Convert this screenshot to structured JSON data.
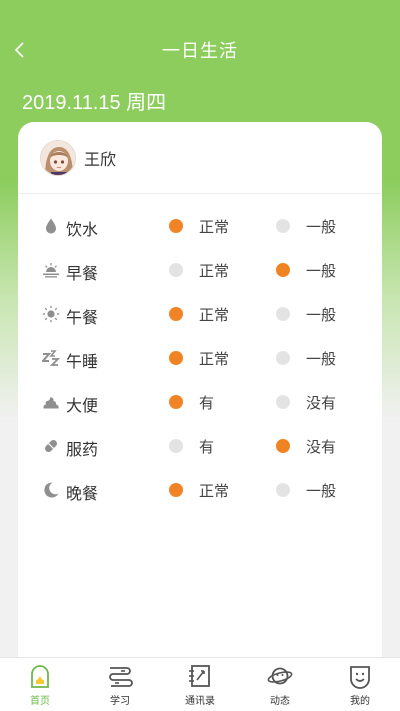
{
  "header": {
    "title": "一日生活"
  },
  "date": "2019.11.15 周四",
  "profile": {
    "name": "王欣"
  },
  "colors": {
    "accent": "#f08424",
    "brand": "#8ccd5e",
    "inactive": "#e3e3e3"
  },
  "rows": [
    {
      "label": "饮水",
      "icon": "water-drop-icon",
      "options": [
        "正常",
        "一般"
      ],
      "selected": 0
    },
    {
      "label": "早餐",
      "icon": "sunrise-icon",
      "options": [
        "正常",
        "一般"
      ],
      "selected": 1
    },
    {
      "label": "午餐",
      "icon": "sun-icon",
      "options": [
        "正常",
        "一般"
      ],
      "selected": 0
    },
    {
      "label": "午睡",
      "icon": "sleep-icon",
      "options": [
        "正常",
        "一般"
      ],
      "selected": 0
    },
    {
      "label": "大便",
      "icon": "poop-icon",
      "options": [
        "有",
        "没有"
      ],
      "selected": 0
    },
    {
      "label": "服药",
      "icon": "pill-icon",
      "options": [
        "有",
        "没有"
      ],
      "selected": 1
    },
    {
      "label": "晚餐",
      "icon": "moon-icon",
      "options": [
        "正常",
        "一般"
      ],
      "selected": 0
    }
  ],
  "tabbar": {
    "items": [
      {
        "label": "首页",
        "icon": "home-icon",
        "active": true
      },
      {
        "label": "学习",
        "icon": "study-icon",
        "active": false
      },
      {
        "label": "通讯录",
        "icon": "contacts-icon",
        "active": false
      },
      {
        "label": "动态",
        "icon": "planet-icon",
        "active": false
      },
      {
        "label": "我的",
        "icon": "smiley-icon",
        "active": false
      }
    ]
  }
}
